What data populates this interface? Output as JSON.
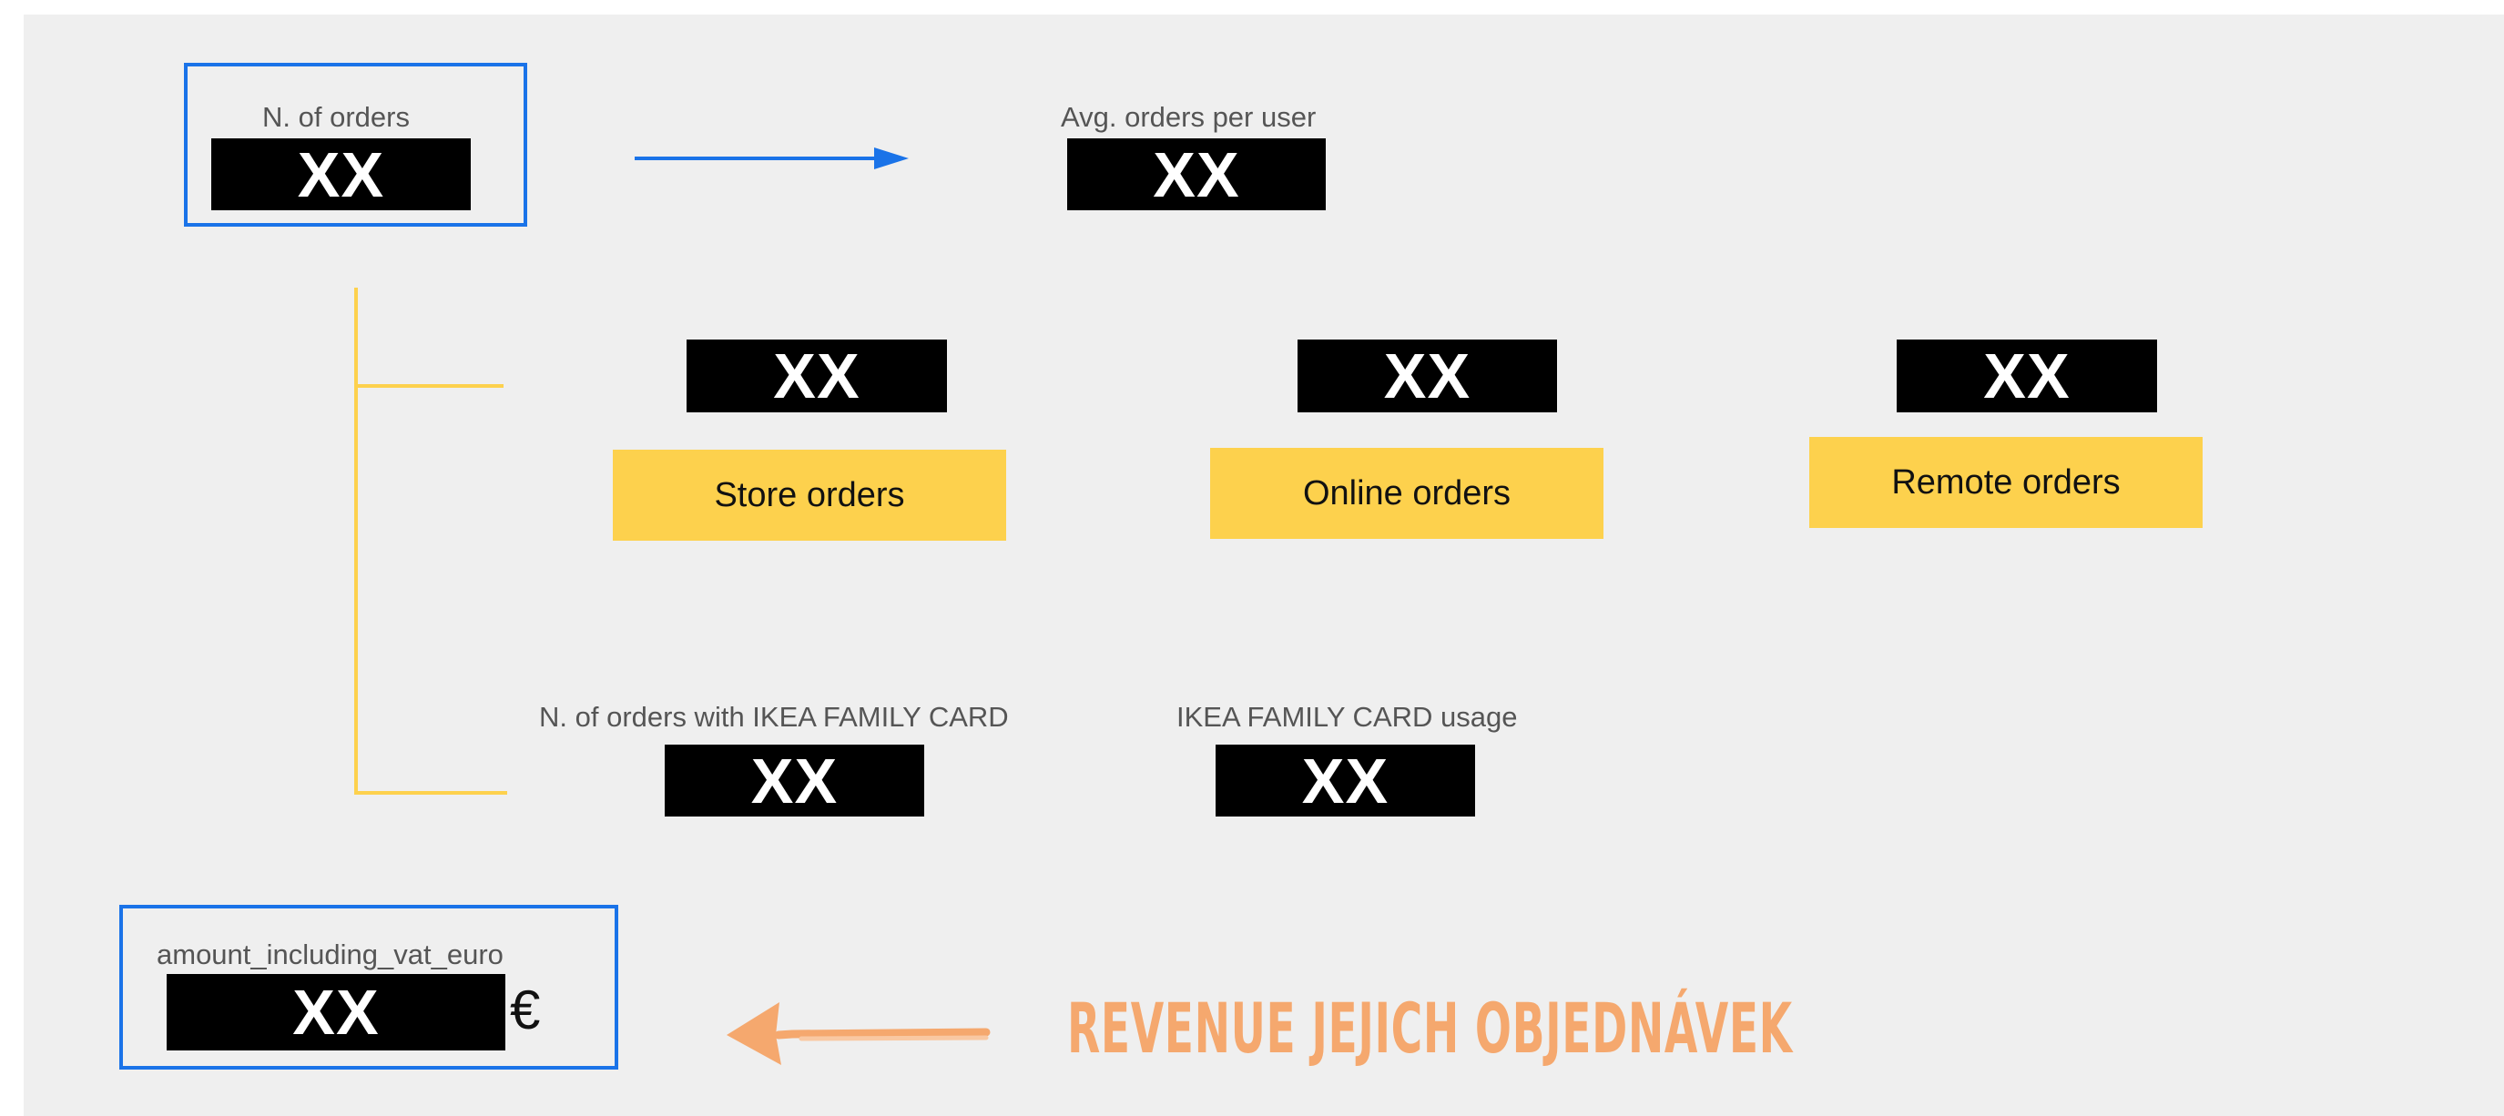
{
  "diagram": {
    "orders": {
      "label": "N. of orders",
      "value": "XX"
    },
    "avg_orders_per_user": {
      "label": "Avg. orders per user",
      "value": "XX"
    },
    "channels": [
      {
        "value": "XX",
        "label": "Store orders"
      },
      {
        "value": "XX",
        "label": "Online orders"
      },
      {
        "value": "XX",
        "label": "Remote orders"
      }
    ],
    "family_card_orders": {
      "label": "N. of orders with IKEA FAMILY CARD",
      "value": "XX"
    },
    "family_card_usage": {
      "label": "IKEA FAMILY CARD usage",
      "value": "XX"
    },
    "amount": {
      "label": "amount_including_vat_euro",
      "value": "XX",
      "currency": "€"
    },
    "annotation": "REVENUE JEJICH OBJEDNÁVEK"
  },
  "colors": {
    "background": "#efefef",
    "value_box": "#000000",
    "channel_box": "#fdd14d",
    "highlight_border": "#1a73e8",
    "branch_line": "#fdd14d",
    "annotation": "#f5a86e"
  }
}
